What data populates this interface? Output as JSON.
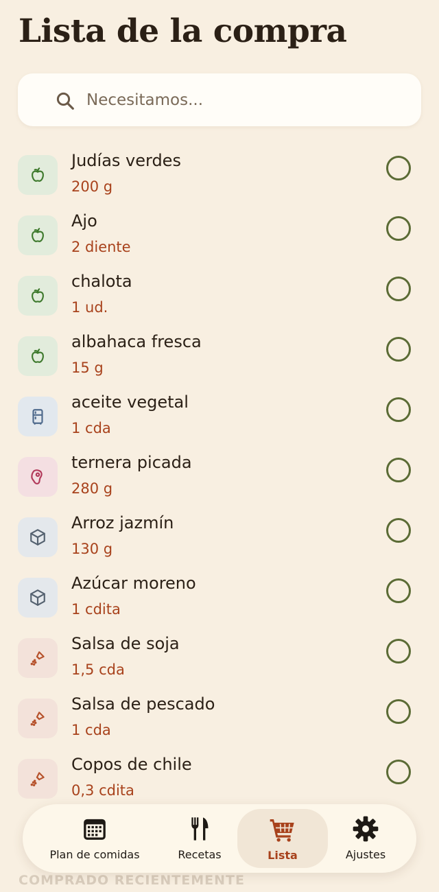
{
  "header": {
    "title": "Lista de la compra"
  },
  "search": {
    "placeholder": "Necesitamos..."
  },
  "items": [
    {
      "name": "Judías verdes",
      "qty": "200 g",
      "category": "produce",
      "icon": "apple-icon"
    },
    {
      "name": "Ajo",
      "qty": "2 diente",
      "category": "produce",
      "icon": "apple-icon"
    },
    {
      "name": "chalota",
      "qty": "1 ud.",
      "category": "produce",
      "icon": "apple-icon"
    },
    {
      "name": "albahaca fresca",
      "qty": "15 g",
      "category": "produce",
      "icon": "apple-icon"
    },
    {
      "name": "aceite vegetal",
      "qty": "1 cda",
      "category": "fridge",
      "icon": "fridge-icon"
    },
    {
      "name": "ternera picada",
      "qty": "280 g",
      "category": "meat",
      "icon": "meat-icon"
    },
    {
      "name": "Arroz jazmín",
      "qty": "130 g",
      "category": "pantry",
      "icon": "box-icon"
    },
    {
      "name": "Azúcar moreno",
      "qty": "1 cdita",
      "category": "pantry",
      "icon": "box-icon"
    },
    {
      "name": "Salsa de soja",
      "qty": "1,5 cda",
      "category": "spice",
      "icon": "spice-shaker-icon"
    },
    {
      "name": "Salsa de pescado",
      "qty": "1 cda",
      "category": "spice",
      "icon": "spice-shaker-icon"
    },
    {
      "name": "Copos de chile",
      "qty": "0,3 cdita",
      "category": "spice",
      "icon": "spice-shaker-icon"
    }
  ],
  "recent": {
    "label": "COMPRADO RECIENTEMENTE"
  },
  "nav": {
    "tabs": [
      {
        "label": "Plan de comidas",
        "icon": "calendar-icon"
      },
      {
        "label": "Recetas",
        "icon": "fork-knife-icon"
      },
      {
        "label": "Lista",
        "icon": "cart-icon",
        "active": true
      },
      {
        "label": "Ajustes",
        "icon": "gear-icon"
      }
    ]
  },
  "colors": {
    "background": "#f8efe1",
    "accent": "#a8421c",
    "checkbox": "#5b6b35",
    "produce_icon": "#3f7a2e",
    "fridge_icon": "#4f6a8c",
    "meat_icon": "#b23a5b",
    "pantry_icon": "#556270",
    "spice_icon": "#b6522c"
  }
}
